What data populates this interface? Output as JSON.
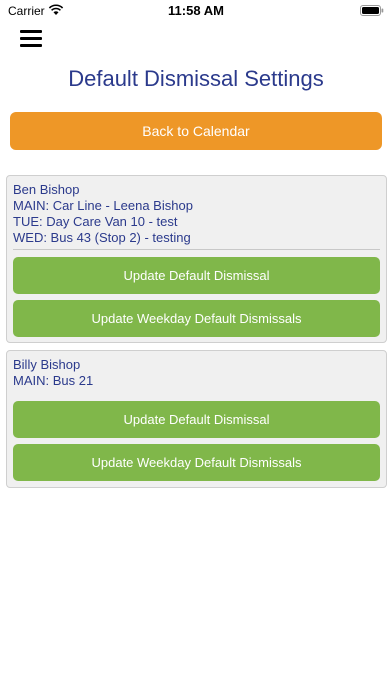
{
  "status_bar": {
    "carrier": "Carrier",
    "time": "11:58 AM"
  },
  "header": {
    "title": "Default Dismissal Settings"
  },
  "back_button": {
    "label": "Back to Calendar",
    "color": "#ee9727"
  },
  "students": [
    {
      "lines": [
        "Ben Bishop",
        "MAIN: Car Line - Leena Bishop",
        "TUE: Day Care Van 10 - test",
        "WED: Bus 43 (Stop 2) - testing"
      ],
      "update_default_label": "Update Default Dismissal",
      "update_weekday_label": "Update Weekday Default Dismissals"
    },
    {
      "lines": [
        "Billy Bishop",
        "MAIN: Bus 21"
      ],
      "update_default_label": "Update Default Dismissal",
      "update_weekday_label": "Update Weekday Default Dismissals"
    }
  ],
  "colors": {
    "title_text": "#2b3a8c",
    "action_button": "#80b74a"
  },
  "icons": [
    "wifi-icon",
    "battery-icon",
    "menu-icon"
  ]
}
